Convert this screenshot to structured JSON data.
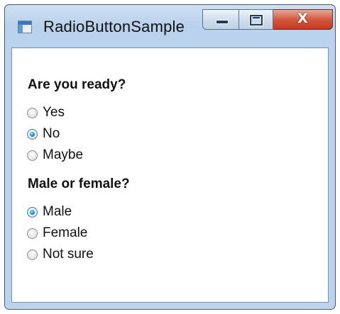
{
  "window": {
    "title": "RadioButtonSample",
    "icon": "app-window-icon",
    "controls": {
      "minimize_icon": "minimize-icon",
      "maximize_icon": "maximize-icon",
      "close_glyph": "X"
    },
    "close_color": "#c6381f"
  },
  "groups": [
    {
      "heading": "Are you ready?",
      "options": [
        {
          "label": "Yes",
          "checked": false
        },
        {
          "label": "No",
          "checked": true
        },
        {
          "label": "Maybe",
          "checked": false
        }
      ]
    },
    {
      "heading": "Male or female?",
      "options": [
        {
          "label": "Male",
          "checked": true
        },
        {
          "label": "Female",
          "checked": false
        },
        {
          "label": "Not sure",
          "checked": false
        }
      ]
    }
  ],
  "colors": {
    "radio_selected": "#1f8cc9",
    "titlebar": "#bcd3ee"
  }
}
